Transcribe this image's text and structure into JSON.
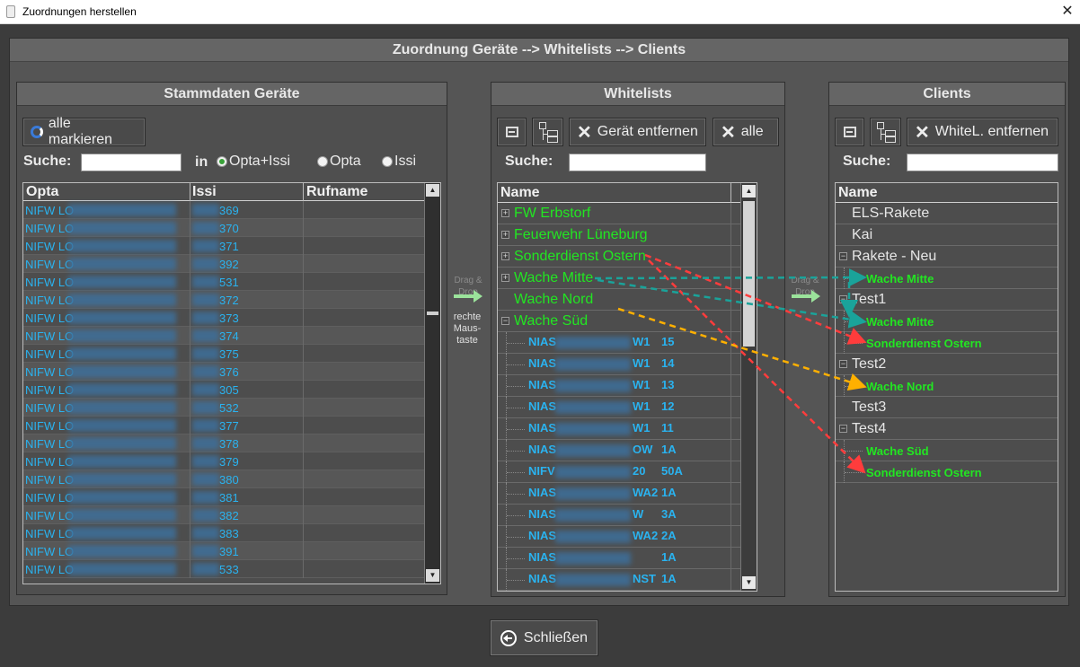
{
  "window": {
    "title": "Zuordnungen herstellen",
    "close_glyph": "✕"
  },
  "main": {
    "header": "Zuordnung Geräte  -->  Whitelists  -->  Clients"
  },
  "devices": {
    "header": "Stammdaten Geräte",
    "mark_all": "alle markieren",
    "search_label": "Suche:",
    "search_value": "",
    "in_label": "in",
    "radios": [
      {
        "label": "Opta+Issi",
        "selected": true
      },
      {
        "label": "Opta",
        "selected": false
      },
      {
        "label": "Issi",
        "selected": false
      }
    ],
    "columns": [
      "Opta",
      "Issi",
      "Rufname"
    ],
    "rows": [
      {
        "opta": "NIFW LO",
        "issi": "369",
        "rufname": ""
      },
      {
        "opta": "NIFW LO",
        "issi": "370",
        "rufname": ""
      },
      {
        "opta": "NIFW LO",
        "issi": "371",
        "rufname": ""
      },
      {
        "opta": "NIFW LO",
        "issi": "392",
        "rufname": ""
      },
      {
        "opta": "NIFW LO",
        "issi": "531",
        "rufname": ""
      },
      {
        "opta": "NIFW LO",
        "issi": "372",
        "rufname": ""
      },
      {
        "opta": "NIFW LO",
        "issi": "373",
        "rufname": ""
      },
      {
        "opta": "NIFW LO",
        "issi": "374",
        "rufname": ""
      },
      {
        "opta": "NIFW LO",
        "issi": "375",
        "rufname": ""
      },
      {
        "opta": "NIFW LO",
        "issi": "376",
        "rufname": ""
      },
      {
        "opta": "NIFW LO",
        "issi": "305",
        "rufname": ""
      },
      {
        "opta": "NIFW LO",
        "issi": "532",
        "rufname": ""
      },
      {
        "opta": "NIFW LO",
        "issi": "377",
        "rufname": ""
      },
      {
        "opta": "NIFW LO",
        "issi": "378",
        "rufname": ""
      },
      {
        "opta": "NIFW LO",
        "issi": "379",
        "rufname": ""
      },
      {
        "opta": "NIFW LO",
        "issi": "380",
        "rufname": ""
      },
      {
        "opta": "NIFW LO",
        "issi": "381",
        "rufname": ""
      },
      {
        "opta": "NIFW LO",
        "issi": "382",
        "rufname": ""
      },
      {
        "opta": "NIFW LO",
        "issi": "383",
        "rufname": ""
      },
      {
        "opta": "NIFW LO",
        "issi": "391",
        "rufname": ""
      },
      {
        "opta": "NIFW LO",
        "issi": "533",
        "rufname": ""
      }
    ]
  },
  "dragdrop": {
    "left_label": "Drag & Drop",
    "left_note": "rechte Maus-taste",
    "right_label": "Drag & Drop"
  },
  "whitelists": {
    "header": "Whitelists",
    "remove_device": "Gerät entfernen",
    "remove_all": "alle",
    "search_label": "Suche:",
    "search_value": "",
    "column": "Name",
    "groups": [
      {
        "name": "FW Erbstorf",
        "expanded": false
      },
      {
        "name": "Feuerwehr Lüneburg",
        "expanded": false
      },
      {
        "name": "Sonderdienst Ostern",
        "expanded": false
      },
      {
        "name": "Wache Mitte",
        "expanded": false
      },
      {
        "name": "Wache Nord",
        "expanded": false
      },
      {
        "name": "Wache Süd",
        "expanded": true
      }
    ],
    "children": [
      {
        "a": "NIAS",
        "b": "W1",
        "c": "15"
      },
      {
        "a": "NIAS",
        "b": "W1",
        "c": "14"
      },
      {
        "a": "NIAS",
        "b": "W1",
        "c": "13"
      },
      {
        "a": "NIAS",
        "b": "W1",
        "c": "12"
      },
      {
        "a": "NIAS",
        "b": "W1",
        "c": "11"
      },
      {
        "a": "NIAS",
        "b": "OW",
        "c": "1A"
      },
      {
        "a": "NIFV",
        "b": "20",
        "c": "50A"
      },
      {
        "a": "NIAS",
        "b": "WA2",
        "c": "1A"
      },
      {
        "a": "NIAS",
        "b": "W",
        "c": "3A"
      },
      {
        "a": "NIAS",
        "b": "WA2",
        "c": "2A"
      },
      {
        "a": "NIAS",
        "b": "",
        "c": "1A"
      },
      {
        "a": "NIAS",
        "b": "NST",
        "c": "1A"
      }
    ]
  },
  "clients": {
    "header": "Clients",
    "remove_whitelist": "WhiteL. entfernen",
    "search_label": "Suche:",
    "search_value": "",
    "column": "Name",
    "items": [
      {
        "name": "ELS-Rakete",
        "level": 0,
        "toggle": ""
      },
      {
        "name": "Kai",
        "level": 0,
        "toggle": ""
      },
      {
        "name": "Rakete - Neu",
        "level": 0,
        "toggle": "−"
      },
      {
        "name": "Wache Mitte",
        "level": 1,
        "toggle": ""
      },
      {
        "name": "Test1",
        "level": 0,
        "toggle": "−"
      },
      {
        "name": "Wache Mitte",
        "level": 1,
        "toggle": ""
      },
      {
        "name": "Sonderdienst Ostern",
        "level": 1,
        "toggle": ""
      },
      {
        "name": "Test2",
        "level": 0,
        "toggle": "−"
      },
      {
        "name": "Wache Nord",
        "level": 1,
        "toggle": ""
      },
      {
        "name": "Test3",
        "level": 0,
        "toggle": ""
      },
      {
        "name": "Test4",
        "level": 0,
        "toggle": "−"
      },
      {
        "name": "Wache Süd",
        "level": 1,
        "toggle": ""
      },
      {
        "name": "Sonderdienst Ostern",
        "level": 1,
        "toggle": ""
      }
    ]
  },
  "footer": {
    "close_label": "Schließen"
  },
  "colors": {
    "device_text": "#2ab3f0",
    "whitelist_text": "#22e622",
    "client_text": "#e6e6e6",
    "arrow_red": "#ff3c3c",
    "arrow_teal": "#1aa39a",
    "arrow_orange": "#ffb000"
  }
}
